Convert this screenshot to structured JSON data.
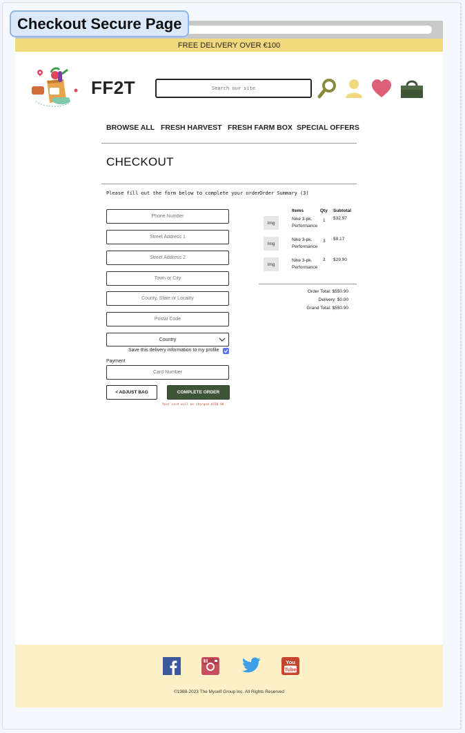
{
  "frame": {
    "label": "Checkout Secure Page"
  },
  "promo": {
    "text": "FREE DELIVERY OVER €100"
  },
  "header": {
    "brand": "FF2T",
    "search_placeholder": "Search our site",
    "icons": [
      "search-icon",
      "user-icon",
      "heart-icon",
      "bag-icon"
    ],
    "colors": {
      "search": "#8b8a3c",
      "user": "#f2d97e",
      "heart": "#dd5f78",
      "bag": "#3e5537"
    }
  },
  "nav": {
    "items": [
      {
        "label": "BROWSE ALL"
      },
      {
        "label": "FRESH HARVEST"
      },
      {
        "label": "FRESH FARM BOX"
      },
      {
        "label": "SPECIAL OFFERS"
      }
    ]
  },
  "page": {
    "title": "CHECKOUT"
  },
  "form": {
    "instructions": "Please fill out the form below to complete your order",
    "fields": {
      "phone": "Phone Number",
      "street1": "Street Address 1",
      "street2": "Street Address 2",
      "town": "Town or City",
      "county": "County, State or Locality",
      "postal": "Postal Code",
      "country": "Country",
      "card": "Card Number"
    },
    "save_label": "Save this delivery information to my profile",
    "save_checked": true,
    "payment_label": "Payment",
    "adjust_button": "< ADJUST BAG",
    "complete_button": "COMPLETE ORDER",
    "charge_note": "Your card will be charged $550.90",
    "colors": {
      "complete": "#3e5537",
      "note": "#d14a2a",
      "checkbox": "#5b74e6"
    }
  },
  "summary": {
    "heading": "Order Summary (3)",
    "headers": {
      "items": "Items",
      "qty": "Qty",
      "subtotal": "Subtotal"
    },
    "items": [
      {
        "img": "Img",
        "name": "Nike 3-pk. Performance",
        "qty": "1",
        "subtotal": "$32.97"
      },
      {
        "img": "Img",
        "name": "Nike 3-pk. Performance",
        "qty": "3",
        "subtotal": "$9.17"
      },
      {
        "img": "Img",
        "name": "Nike 3-pk. Performance",
        "qty": "2",
        "subtotal": "$29.90"
      }
    ],
    "order_total": "Order Total: $550.90",
    "delivery": "Delivery: $0.00",
    "grand_total": "Grand Total: $550.90"
  },
  "footer": {
    "social": [
      "facebook-icon",
      "instagram-icon",
      "twitter-icon",
      "youtube-icon"
    ],
    "youtube_text": [
      "You",
      "Tube"
    ],
    "copyright": "©1988-2023 The Myself Group Inc. All Rights Reserved",
    "background": "#fbf0c8"
  }
}
